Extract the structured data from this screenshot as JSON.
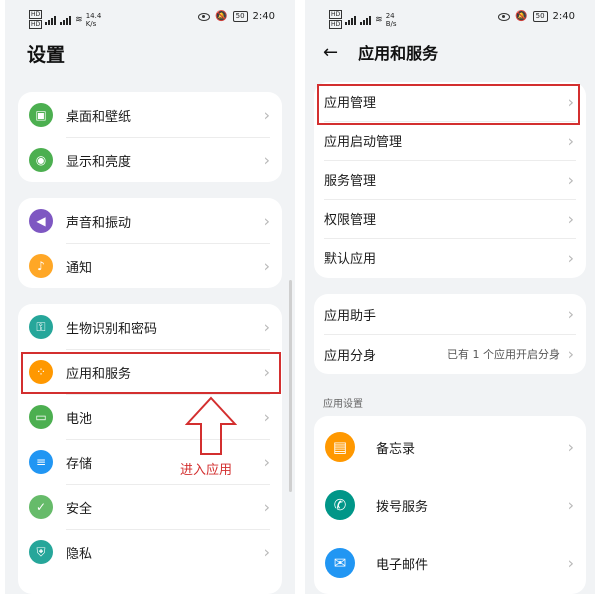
{
  "left": {
    "status": {
      "network": "14.4",
      "network_unit": "K/s",
      "battery": "50",
      "time": "2:40"
    },
    "title": "设置",
    "groups": [
      [
        {
          "label": "桌面和壁纸",
          "icon": "wallpaper-icon",
          "color": "#4caf50"
        },
        {
          "label": "显示和亮度",
          "icon": "eye-icon",
          "color": "#4caf50"
        }
      ],
      [
        {
          "label": "声音和振动",
          "icon": "speaker-icon",
          "color": "#7e57c2"
        },
        {
          "label": "通知",
          "icon": "bell-icon",
          "color": "#ffa726"
        }
      ],
      [
        {
          "label": "生物识别和密码",
          "icon": "key-icon",
          "color": "#26a69a"
        },
        {
          "label": "应用和服务",
          "icon": "apps-icon",
          "color": "#ff9800"
        },
        {
          "label": "电池",
          "icon": "battery-icon",
          "color": "#4caf50"
        },
        {
          "label": "存储",
          "icon": "storage-icon",
          "color": "#2196f3"
        },
        {
          "label": "安全",
          "icon": "shield-icon",
          "color": "#66bb6a"
        },
        {
          "label": "隐私",
          "icon": "privacy-icon",
          "color": "#26a69a"
        }
      ]
    ],
    "annotation": "进入应用"
  },
  "right": {
    "status": {
      "network": "24",
      "network_unit": "B/s",
      "battery": "50",
      "time": "2:40"
    },
    "title": "应用和服务",
    "group1": [
      "应用管理",
      "应用启动管理",
      "服务管理",
      "权限管理",
      "默认应用"
    ],
    "group2": [
      {
        "label": "应用助手",
        "value": ""
      },
      {
        "label": "应用分身",
        "value": "已有 1 个应用开启分身"
      }
    ],
    "section_title": "应用设置",
    "apps": [
      {
        "label": "备忘录",
        "icon": "memo-icon",
        "color": "#ff9800"
      },
      {
        "label": "拨号服务",
        "icon": "phone-icon",
        "color": "#009688"
      },
      {
        "label": "电子邮件",
        "icon": "email-icon",
        "color": "#2196f3"
      }
    ]
  },
  "colors": {
    "accent_red": "#d32f2f"
  }
}
